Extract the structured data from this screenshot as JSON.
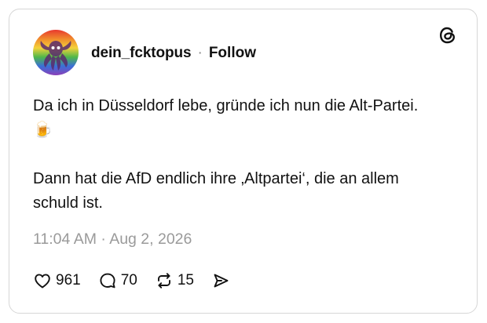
{
  "post": {
    "username": "dein_fcktopus",
    "separator": "·",
    "follow_label": "Follow",
    "paragraphs": [
      "Da ich in Düsseldorf lebe, gründe ich nun die Alt-Partei. 🍺",
      "Dann hat die AfD endlich ihre ‚Altpartei‘, die an allem schuld ist."
    ],
    "timestamp": "11:04 AM · Aug 2, 2026",
    "actions": {
      "likes": "961",
      "replies": "70",
      "reposts": "15"
    }
  },
  "icons": {
    "avatar": "rainbow-octopus-avatar",
    "logo": "threads-logo-icon",
    "like": "heart-icon",
    "reply": "speech-bubble-icon",
    "repost": "repost-arrows-icon",
    "share": "send-icon"
  },
  "colors": {
    "text": "#111111",
    "muted": "#9a9a9a",
    "border": "#d6d6d6"
  }
}
